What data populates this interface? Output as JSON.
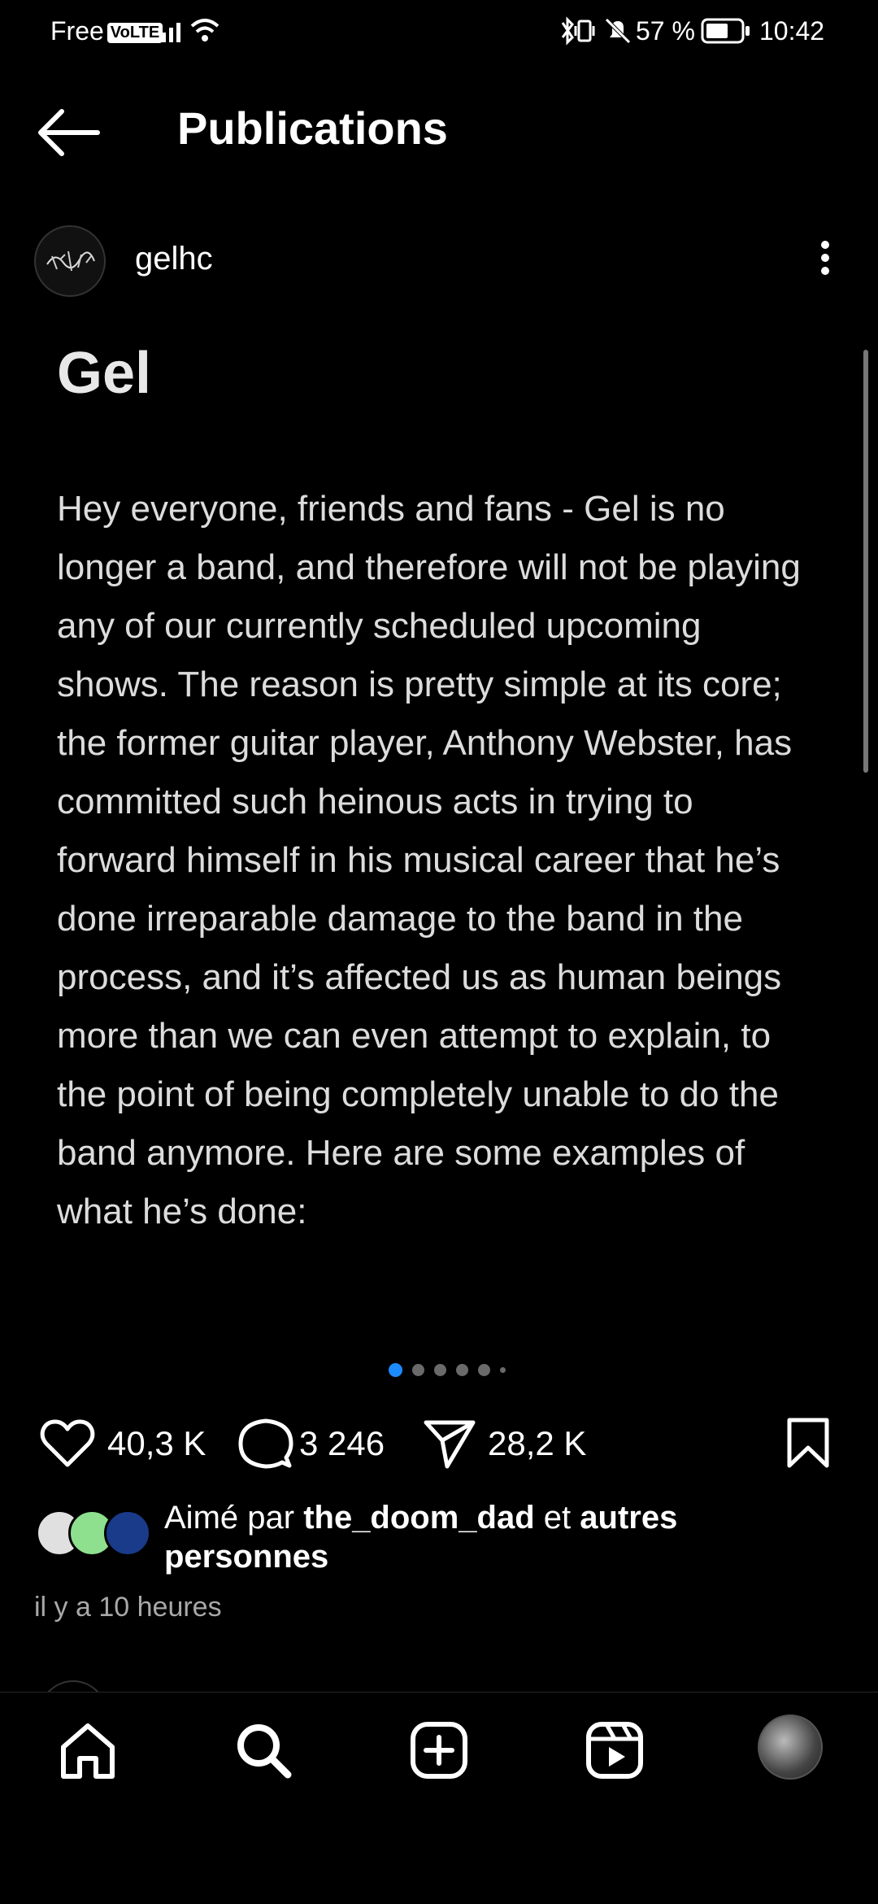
{
  "status_bar": {
    "carrier": "Free",
    "volte": "VoLTE",
    "battery": "57 %",
    "time": "10:42"
  },
  "header": {
    "title": "Publications"
  },
  "post": {
    "username": "gelhc",
    "title": "Gel",
    "body": "Hey everyone, friends and fans - Gel is no longer a band, and therefore will not be playing any of our currently scheduled upcoming shows. The reason is pretty simple at its core; the former guitar player, Anthony Webster, has committed such heinous acts in trying to forward himself in his musical career that he’s done irreparable damage to the band in the process, and it’s affected us as human beings more than we can even attempt to explain, to the point of being completely unable to do the band anymore. Here are some examples of what he’s done:",
    "carousel": {
      "count": 6,
      "active": 1
    },
    "likes": "40,3 K",
    "comments": "3 246",
    "shares": "28,2 K",
    "liked_by_prefix": "Aimé par",
    "liked_by_user": "the_doom_dad",
    "liked_by_join": "et",
    "liked_by_suffix": "autres personnes",
    "timestamp": "il y a 10 heures"
  },
  "nav": {
    "items": [
      "home-icon",
      "search-icon",
      "create-icon",
      "reels-icon",
      "profile-avatar"
    ]
  },
  "colors": {
    "background": "#000000",
    "accent": "#1d8bff",
    "secondary_text": "#a8a8a8"
  }
}
